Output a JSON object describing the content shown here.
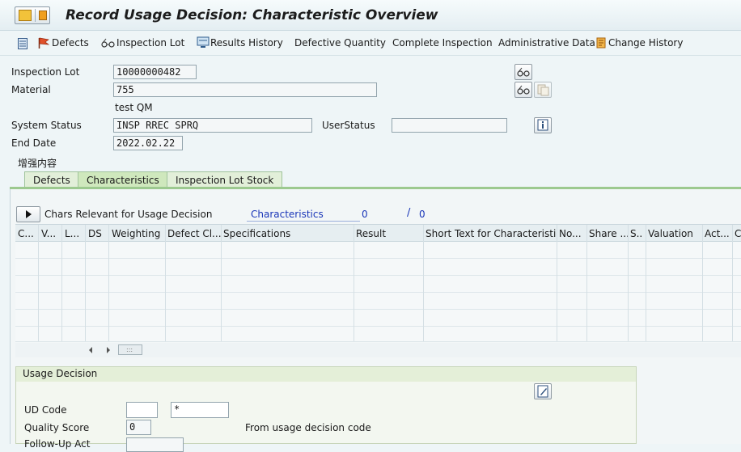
{
  "window": {
    "title": "Record Usage Decision: Characteristic Overview"
  },
  "toolbar": {
    "items": [
      {
        "label": "Defects",
        "icon": "flag-icon"
      },
      {
        "label": "Inspection Lot",
        "icon": "glasses-icon"
      },
      {
        "label": "Results History",
        "icon": "monitor-icon"
      },
      {
        "label": "Defective Quantity"
      },
      {
        "label": "Complete Inspection"
      },
      {
        "label": "Administrative Data"
      },
      {
        "label": "Change History",
        "icon": "history-icon"
      }
    ]
  },
  "header": {
    "inspection_lot_label": "Inspection Lot",
    "inspection_lot_value": "10000000482",
    "material_label": "Material",
    "material_value": "755",
    "material_desc": "test QM",
    "system_status_label": "System Status",
    "system_status_value": "INSP RREC SPRQ",
    "user_status_label": "UserStatus",
    "user_status_value": "",
    "end_date_label": "End Date",
    "end_date_value": "2022.02.22",
    "enhanced_label": "增强内容"
  },
  "tabs": [
    {
      "label": "Defects",
      "active": false
    },
    {
      "label": "Characteristics",
      "active": true
    },
    {
      "label": "Inspection Lot Stock",
      "active": false
    }
  ],
  "characteristics": {
    "section_label": "Chars Relevant for Usage Decision",
    "link_label": "Characteristics",
    "count": "0",
    "separator": "/",
    "total": "0",
    "columns": [
      "C...",
      "V...",
      "L...",
      "DS",
      "Weighting",
      "Defect Cl...",
      "Specifications",
      "Result",
      "Short Text for Characteristic",
      "No...",
      "Share ...",
      "S..",
      "Valuation",
      "Act...",
      "C"
    ],
    "rows": []
  },
  "usage_decision": {
    "title": "Usage Decision",
    "ud_code_label": "UD Code",
    "ud_code_value": "",
    "ud_code_value2": "*",
    "quality_score_label": "Quality Score",
    "quality_score_value": "0",
    "quality_score_note": "From usage decision code",
    "followup_label": "Follow-Up Act"
  },
  "colors": {
    "accent_green": "#9cc98f",
    "link_blue": "#1a36b8"
  }
}
